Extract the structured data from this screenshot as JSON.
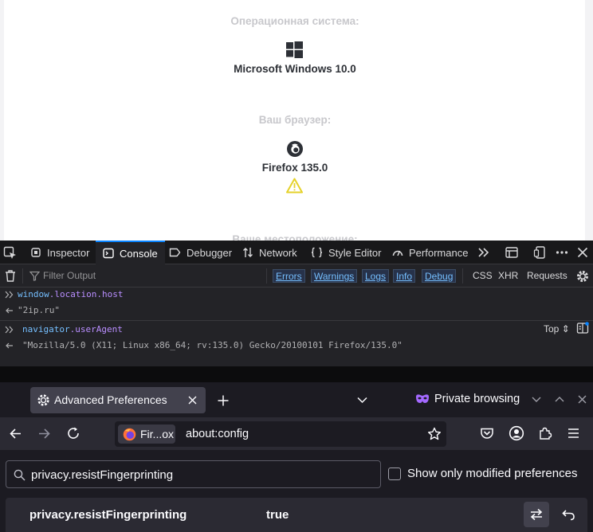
{
  "site": {
    "os_label": "Операционная система:",
    "os_value": "Microsoft Windows 10.0",
    "browser_label": "Ваш браузер:",
    "browser_value": "Firefox 135.0",
    "cut_label": "Ваше местоположение:"
  },
  "devtools": {
    "tabs": [
      {
        "label": "Inspector"
      },
      {
        "label": "Console"
      },
      {
        "label": "Debugger"
      },
      {
        "label": "Network"
      },
      {
        "label": "Style Editor"
      },
      {
        "label": "Performance"
      }
    ],
    "filter_placeholder": "Filter Output",
    "levels": [
      "Errors",
      "Warnings",
      "Logs",
      "Info",
      "Debug"
    ],
    "filters": [
      "CSS",
      "XHR",
      "Requests"
    ],
    "context": "Top",
    "entries": [
      {
        "input_obj": "window",
        "input_prop": ".location.host",
        "output": "\"2ip.ru\""
      },
      {
        "input_obj": "navigator",
        "input_prop": ".userAgent",
        "output": "\"Mozilla/5.0 (X11; Linux x86_64; rv:135.0) Gecko/20100101 Firefox/135.0\""
      }
    ]
  },
  "browser": {
    "tab_title": "Advanced Preferences",
    "private_label": "Private browsing",
    "identity_label": "Fir...ox",
    "url": "about:config",
    "accent": "#0a84ff"
  },
  "config": {
    "search_value": "privacy.resistFingerprinting",
    "modified_only_label": "Show only modified preferences",
    "pref_name": "privacy.resistFingerprinting",
    "pref_value": "true"
  }
}
